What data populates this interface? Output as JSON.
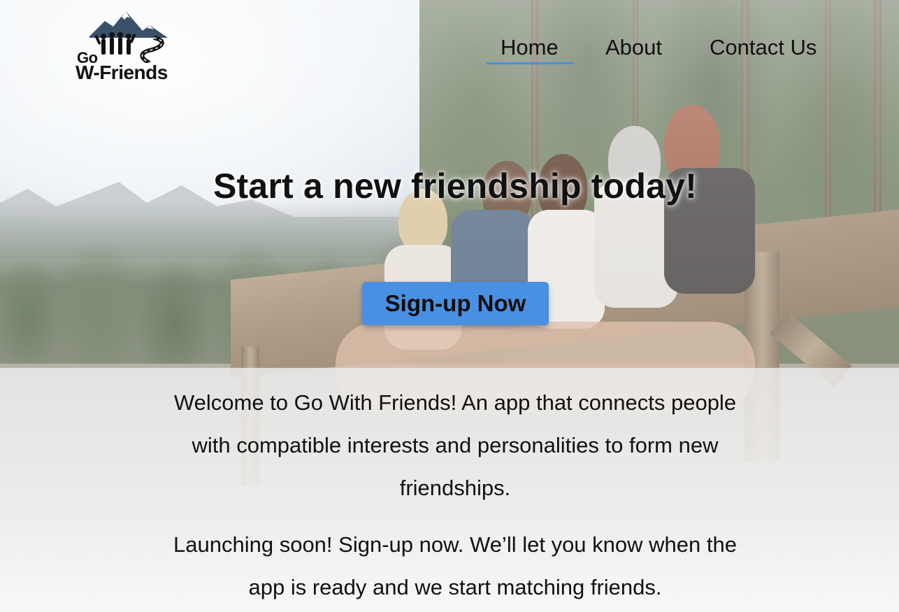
{
  "brand": {
    "logo_go": "Go",
    "logo_name": "W-Friends",
    "accent_color": "#4a90e2"
  },
  "nav": {
    "items": [
      {
        "label": "Home",
        "active": true
      },
      {
        "label": "About",
        "active": false
      },
      {
        "label": "Contact Us",
        "active": false
      }
    ]
  },
  "hero": {
    "title": "Start a new friendship today!",
    "cta_label": "Sign-up Now"
  },
  "content": {
    "intro": "Welcome to Go With Friends! An app that connects people with compatible interests and personalities to form new friendships.",
    "launch": "Launching soon! Sign-up now. We’ll let you know when the app is ready and we start matching friends."
  },
  "icons": {
    "logo": "mountains-friends-road-logo"
  }
}
